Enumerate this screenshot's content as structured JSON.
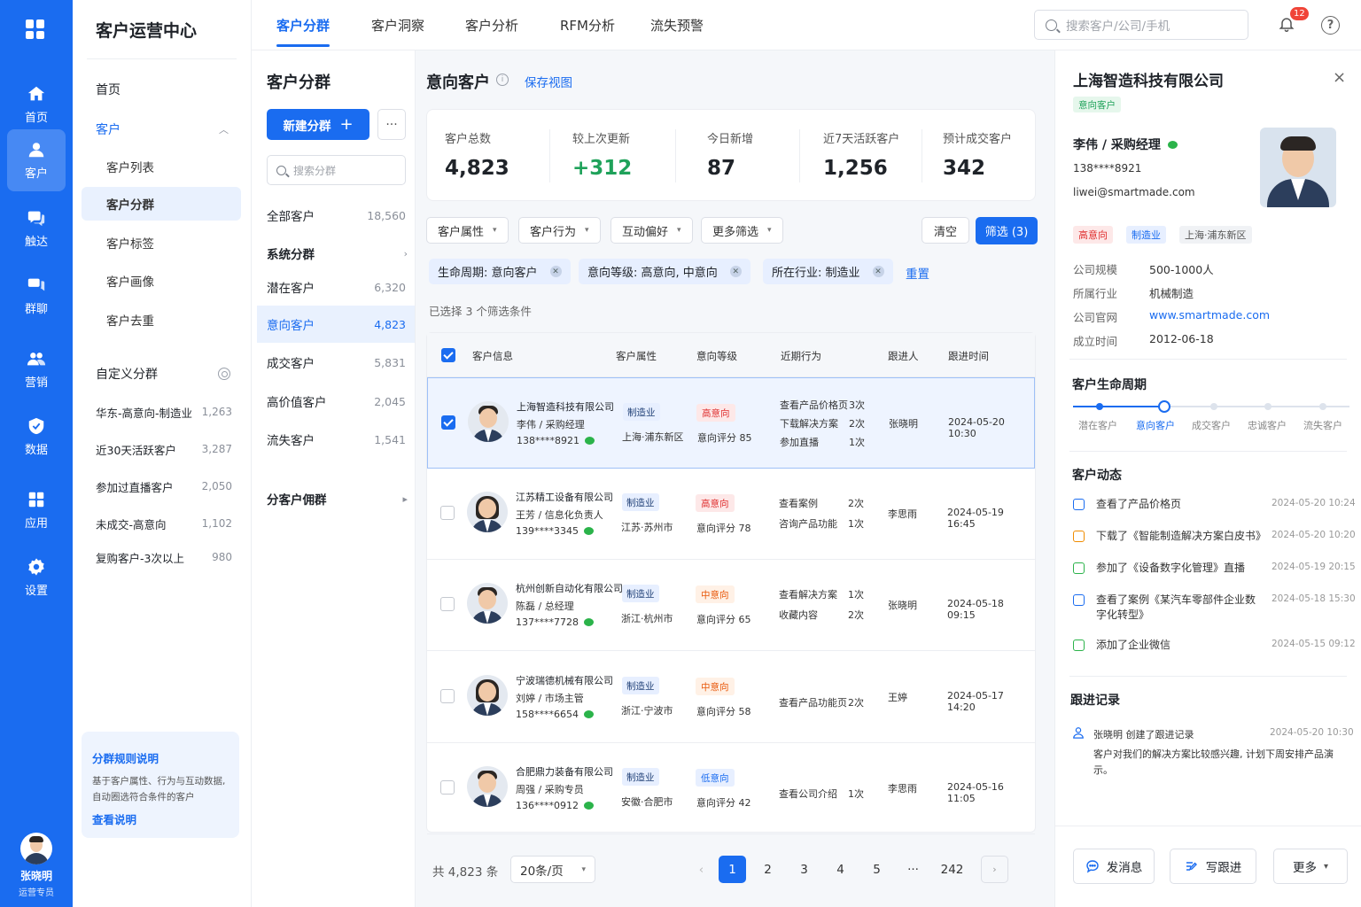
{
  "app": {
    "title": "客户运营中心"
  },
  "rail": {
    "items": [
      {
        "label": "首页",
        "icon": "home-icon"
      },
      {
        "label": "客户",
        "icon": "user-icon"
      },
      {
        "label": "触达",
        "icon": "chat-icon"
      },
      {
        "label": "群聊",
        "icon": "group-chat-icon"
      },
      {
        "label": "营销",
        "icon": "marketing-icon"
      },
      {
        "label": "数据",
        "icon": "data-icon"
      },
      {
        "label": "应用",
        "icon": "apps-icon"
      },
      {
        "label": "设置",
        "icon": "gear-icon"
      }
    ],
    "user": {
      "name": "张晓明",
      "role": "运营专员"
    }
  },
  "nav2": {
    "home": "首页",
    "customer": "客户",
    "sub": [
      "客户列表",
      "客户分群",
      "客户标签",
      "客户画像",
      "客户去重"
    ],
    "custom_title": "自定义分群",
    "custom": [
      {
        "label": "华东-高意向-制造业",
        "count": "1,263"
      },
      {
        "label": "近30天活跃客户",
        "count": "3,287"
      },
      {
        "label": "参加过直播客户",
        "count": "2,050"
      },
      {
        "label": "未成交-高意向",
        "count": "1,102"
      },
      {
        "label": "复购客户-3次以上",
        "count": "980"
      }
    ],
    "rule": {
      "title": "分群规则说明",
      "desc1": "基于客户属性、行为与互动数据,",
      "desc2": "自动圈选符合条件的客户",
      "link": "查看说明"
    }
  },
  "topbar": {
    "tabs": [
      "客户分群",
      "客户洞察",
      "客户分析",
      "RFM分析",
      "流失预警"
    ],
    "search_placeholder": "搜索客户/公司/手机",
    "badge": "12",
    "help": "?"
  },
  "segpanel": {
    "title": "客户分群",
    "new_btn": "新建分群",
    "more": "···",
    "search_placeholder": "搜索分群",
    "all": {
      "label": "全部客户",
      "count": "18,560"
    },
    "system": "系统分群",
    "items": [
      {
        "label": "潜在客户",
        "count": "6,320"
      },
      {
        "label": "意向客户",
        "count": "4,823"
      },
      {
        "label": "成交客户",
        "count": "5,831"
      },
      {
        "label": "高价值客户",
        "count": "2,045"
      },
      {
        "label": "流失客户",
        "count": "1,541"
      }
    ],
    "sub_group": "分客户佣群"
  },
  "main": {
    "title": "意向客户",
    "save_view": "保存视图",
    "stats": [
      {
        "label": "客户总数",
        "value": "4,823"
      },
      {
        "label": "较上次更新",
        "value": "+312"
      },
      {
        "label": "今日新增",
        "value": "87"
      },
      {
        "label": "近7天活跃客户",
        "value": "1,256"
      },
      {
        "label": "预计成交客户",
        "value": "342"
      }
    ],
    "filters": [
      "客户属性",
      "客户行为",
      "互动偏好",
      "更多筛选"
    ],
    "clear": "清空",
    "apply": "筛选 (3)",
    "chips": [
      "生命周期: 意向客户",
      "意向等级: 高意向, 中意向",
      "所在行业: 制造业"
    ],
    "reset": "重置",
    "selected": "已选择 3 个筛选条件",
    "columns": [
      "客户信息",
      "客户属性",
      "意向等级",
      "近期行为",
      "跟进人",
      "跟进时间"
    ],
    "rows": [
      {
        "company": "上海智造科技有限公司",
        "person": "李伟 / 采购经理",
        "phone": "138****8921",
        "industry": "制造业",
        "region": "上海·浦东新区",
        "level": "高意向",
        "level_class": "high",
        "score": "意向评分 85",
        "acts": [
          [
            "查看产品价格页",
            "3次"
          ],
          [
            "下载解决方案",
            "2次"
          ],
          [
            "参加直播",
            "1次"
          ]
        ],
        "owner": "张晓明",
        "time": "2024-05-20 10:30",
        "gender": "m"
      },
      {
        "company": "江苏精工设备有限公司",
        "person": "王芳 / 信息化负责人",
        "phone": "139****3345",
        "industry": "制造业",
        "region": "江苏·苏州市",
        "level": "高意向",
        "level_class": "high",
        "score": "意向评分 78",
        "acts": [
          [
            "查看案例",
            "2次"
          ],
          [
            "咨询产品功能",
            "1次"
          ]
        ],
        "owner": "李思雨",
        "time": "2024-05-19 16:45",
        "gender": "f"
      },
      {
        "company": "杭州创新自动化有限公司",
        "person": "陈磊 / 总经理",
        "phone": "137****7728",
        "industry": "制造业",
        "region": "浙江·杭州市",
        "level": "中意向",
        "level_class": "mid",
        "score": "意向评分 65",
        "acts": [
          [
            "查看解决方案",
            "1次"
          ],
          [
            "收藏内容",
            "2次"
          ]
        ],
        "owner": "张晓明",
        "time": "2024-05-18 09:15",
        "gender": "m"
      },
      {
        "company": "宁波瑞德机械有限公司",
        "person": "刘婷 / 市场主管",
        "phone": "158****6654",
        "industry": "制造业",
        "region": "浙江·宁波市",
        "level": "中意向",
        "level_class": "mid",
        "score": "意向评分 58",
        "acts": [
          [
            "查看产品功能页",
            "2次"
          ]
        ],
        "owner": "王婷",
        "time": "2024-05-17 14:20",
        "gender": "f"
      },
      {
        "company": "合肥鼎力装备有限公司",
        "person": "周强 / 采购专员",
        "phone": "136****0912",
        "industry": "制造业",
        "region": "安徽·合肥市",
        "level": "低意向",
        "level_class": "low",
        "score": "意向评分 42",
        "acts": [
          [
            "查看公司介绍",
            "1次"
          ]
        ],
        "owner": "李思雨",
        "time": "2024-05-16 11:05",
        "gender": "m"
      }
    ],
    "pager": {
      "total": "共 4,823 条",
      "size": "20条/页",
      "pages": [
        "1",
        "2",
        "3",
        "4",
        "5",
        "···",
        "242"
      ],
      "prev": "‹",
      "next": "›"
    }
  },
  "detail": {
    "name": "上海智造科技有限公司",
    "close": "×",
    "stage_tag": "意向客户",
    "person": "李伟 / 采购经理",
    "phone": "138****8921",
    "email": "liwei@smartmade.com",
    "tags": [
      "高意向",
      "制造业",
      "上海·浦东新区"
    ],
    "kv": [
      {
        "k": "公司规模",
        "v": "500-1000人"
      },
      {
        "k": "所属行业",
        "v": "机械制造"
      },
      {
        "k": "公司官网",
        "v": "www.smartmade.com"
      },
      {
        "k": "成立时间",
        "v": "2012-06-18"
      }
    ],
    "lifecycle_title": "客户生命周期",
    "lifecycle": [
      "潜在客户",
      "意向客户",
      "成交客户",
      "忠诚客户",
      "流失客户"
    ],
    "events_title": "客户动态",
    "events": [
      {
        "text": "查看了产品价格页",
        "time": "2024-05-20 10:24",
        "color": "#1a6cf0"
      },
      {
        "text": "下载了《智能制造解决方案白皮书》",
        "time": "2024-05-20 10:20",
        "color": "#f08c00"
      },
      {
        "text": "参加了《设备数字化管理》直播",
        "time": "2024-05-19 20:15",
        "color": "#2bb34a"
      },
      {
        "text": "查看了案例《某汽车零部件企业数字化转型》",
        "time": "2024-05-18 15:30",
        "color": "#1a6cf0"
      },
      {
        "text": "添加了企业微信",
        "time": "2024-05-15 09:12",
        "color": "#2bb34a"
      }
    ],
    "followup_title": "跟进记录",
    "followup": {
      "who": "张晓明  创建了跟进记录",
      "time": "2024-05-20 10:30",
      "text": "客户对我们的解决方案比较感兴趣, 计划下周安排产品演示。"
    },
    "actions": [
      "发消息",
      "写跟进",
      "更多"
    ]
  }
}
